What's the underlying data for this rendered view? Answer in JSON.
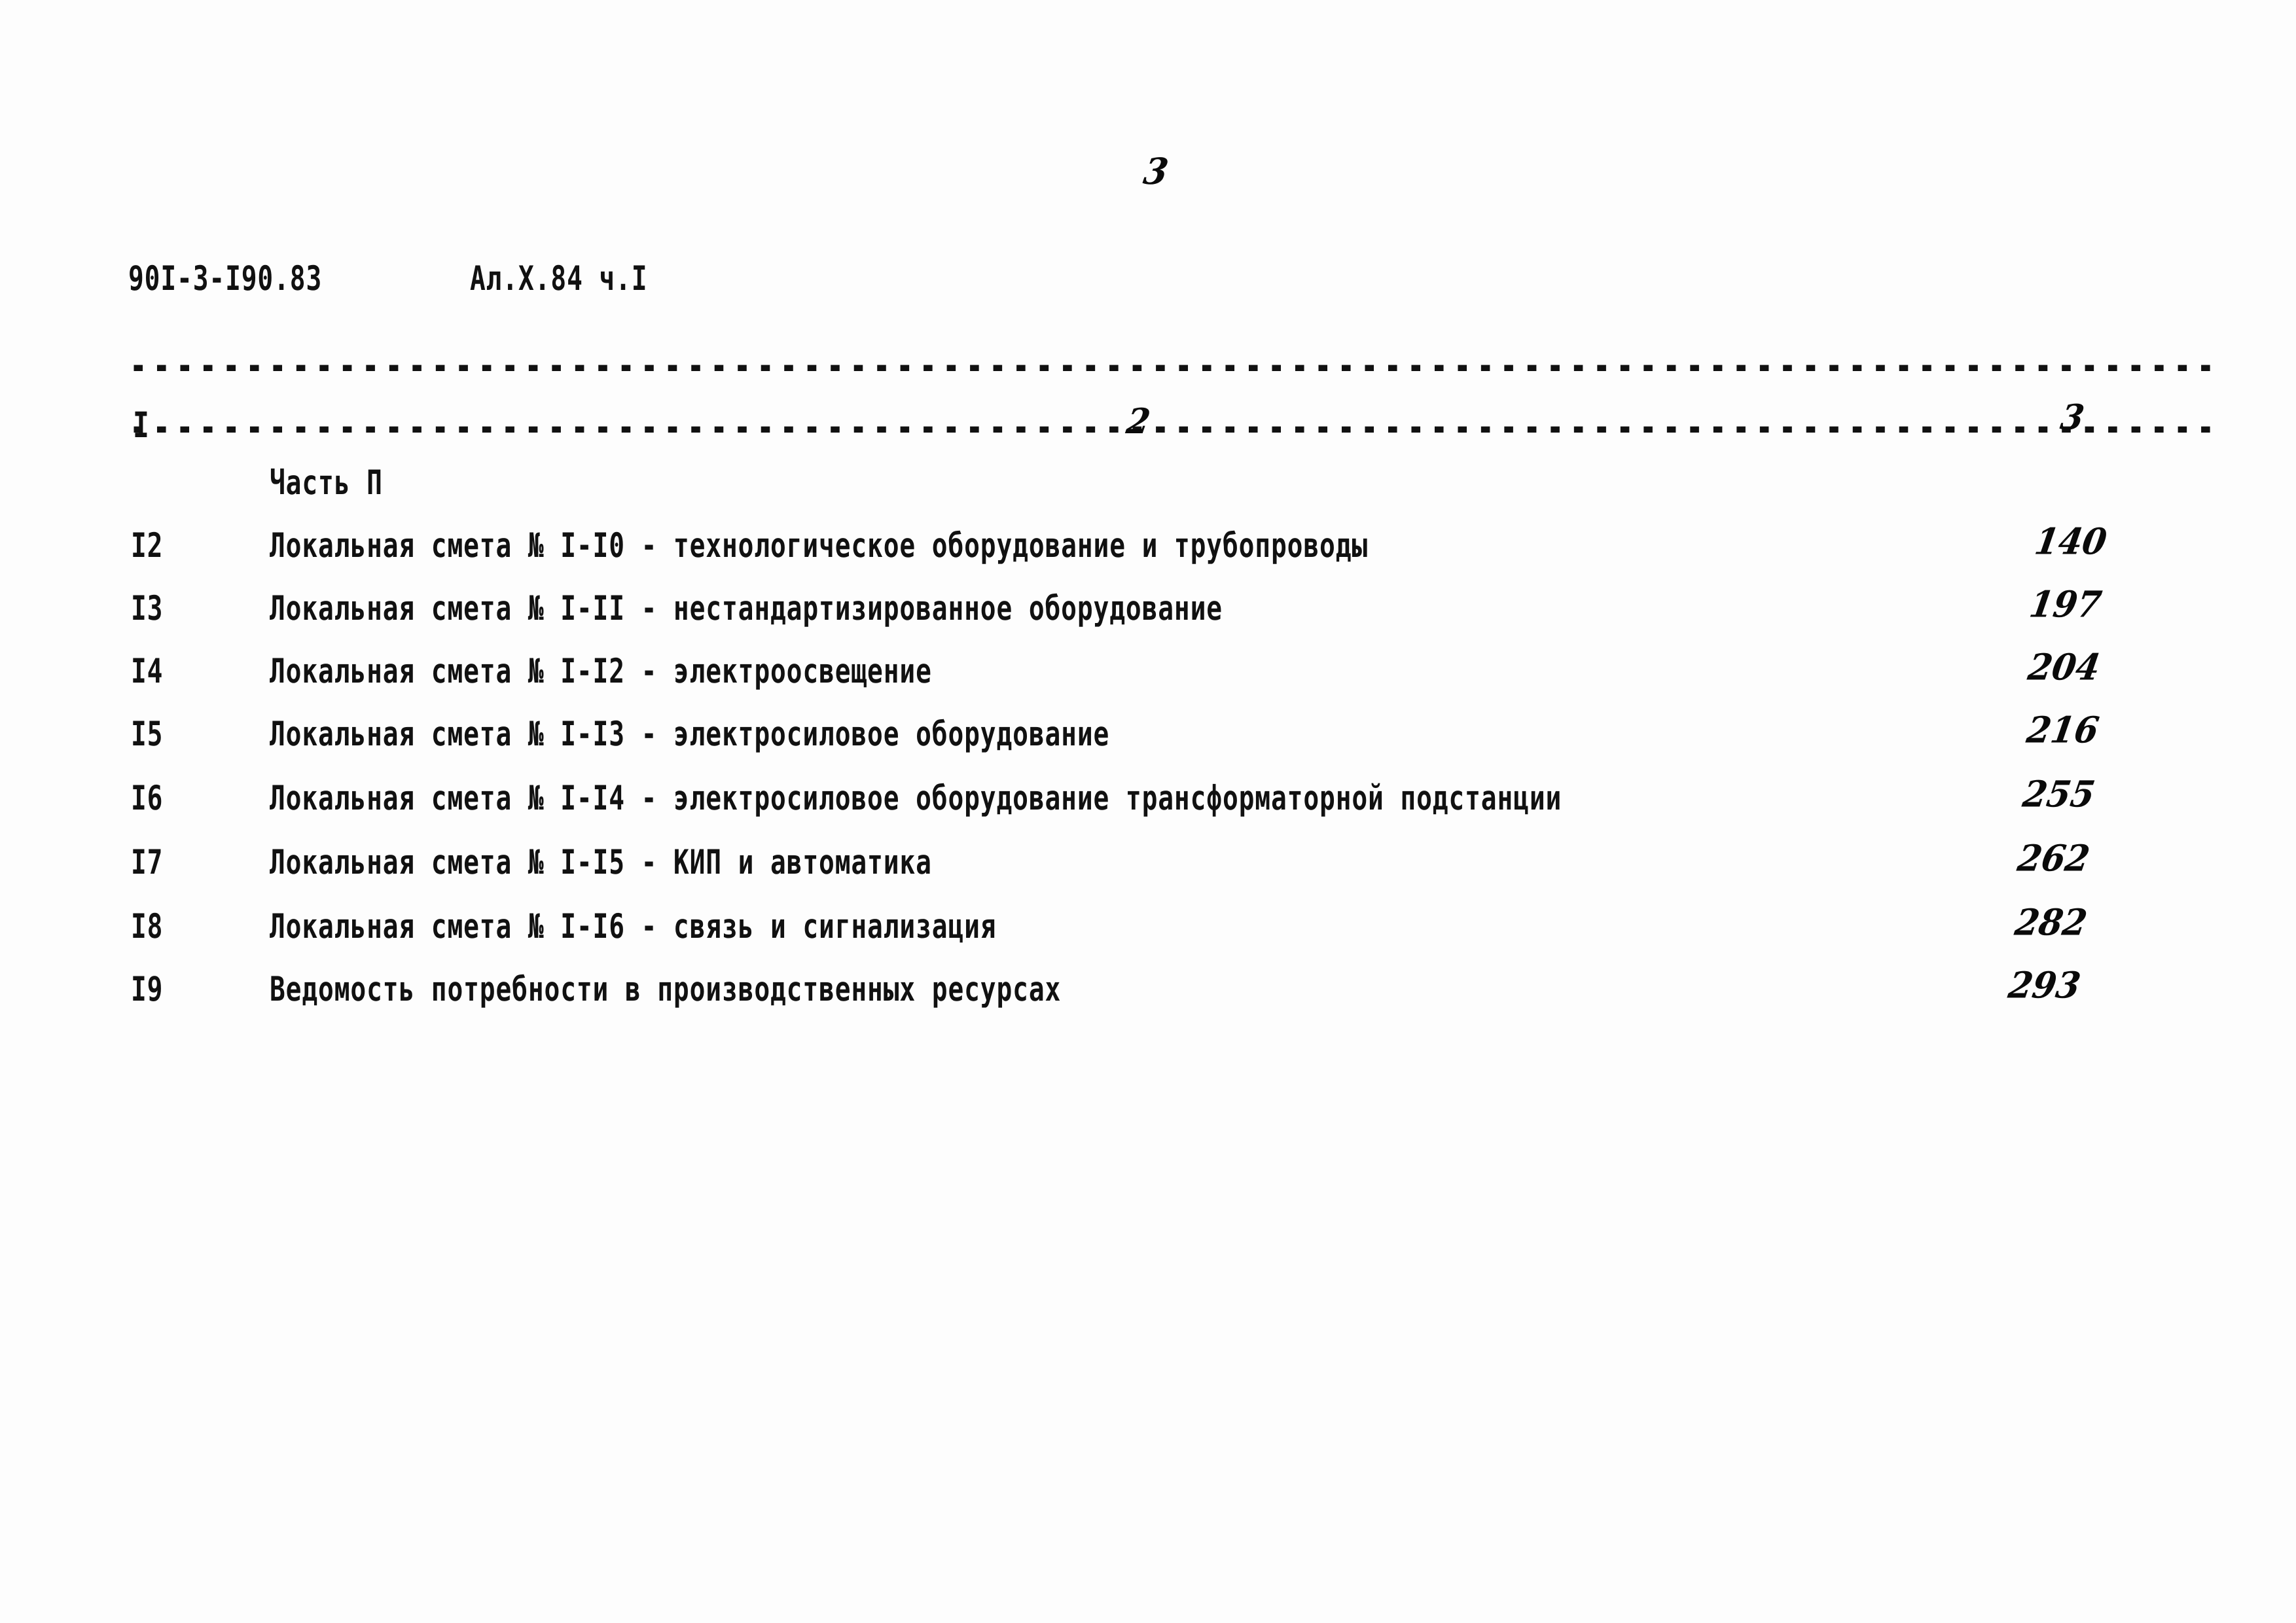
{
  "page": {
    "page_number_top": "3",
    "doc_code": "90I-3-I90.83",
    "album_code": "Ал.X.84 ч.I"
  },
  "table": {
    "column_numbers": {
      "col1": "I",
      "col2": "2",
      "col3": "3"
    },
    "section_title": "Часть П",
    "rows": [
      {
        "num": "I2",
        "title": "Локальная смета № I-I0 - технологическое оборудование и трубопроводы",
        "page": "140"
      },
      {
        "num": "I3",
        "title": "Локальная смета № I-II - нестандартизированное оборудование",
        "page": "197"
      },
      {
        "num": "I4",
        "title": "Локальная смета № I-I2 - электроосвещение",
        "page": "204"
      },
      {
        "num": "I5",
        "title": "Локальная смета № I-I3 - электросиловое оборудование",
        "page": "216"
      },
      {
        "num": "I6",
        "title": "Локальная смета № I-I4 - электросиловое оборудование трансформаторной подстанции",
        "page": "255"
      },
      {
        "num": "I7",
        "title": "Локальная смета № I-I5 - КИП и автоматика",
        "page": "262"
      },
      {
        "num": "I8",
        "title": "Локальная смета № I-I6 - связь и сигнализация",
        "page": "282"
      },
      {
        "num": "I9",
        "title": "Ведомость потребности в производственных ресурсах",
        "page": "293"
      }
    ]
  },
  "rules": {
    "dash_char": "-"
  }
}
